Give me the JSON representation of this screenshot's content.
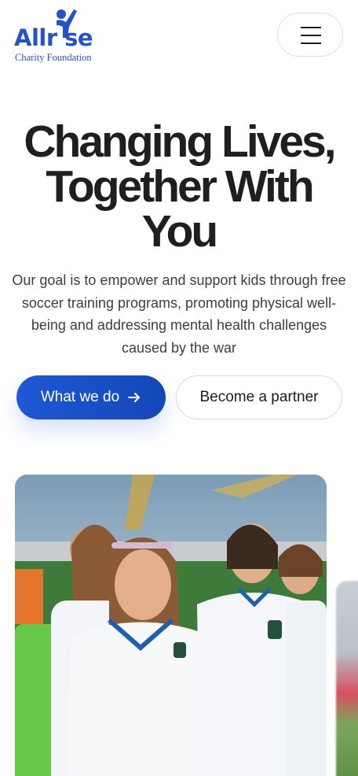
{
  "brand": {
    "name": "Allrise",
    "tagline": "Charity Foundation",
    "color": "#2553c7"
  },
  "header": {
    "menu_icon": "hamburger-icon"
  },
  "hero": {
    "title_line1": "Changing Lives,",
    "title_line2": "Together With",
    "title_line3": "You",
    "description": "Our goal is to empower and support kids through free soccer training programs, promoting physical well-being and addressing mental health challenges caused by the war",
    "primary_button": "What we do",
    "primary_icon": "arrow-right-icon",
    "secondary_button": "Become a partner",
    "accent_color": "#1f58d6"
  },
  "gallery": {
    "image_subject": "girls-soccer-team-photo"
  }
}
